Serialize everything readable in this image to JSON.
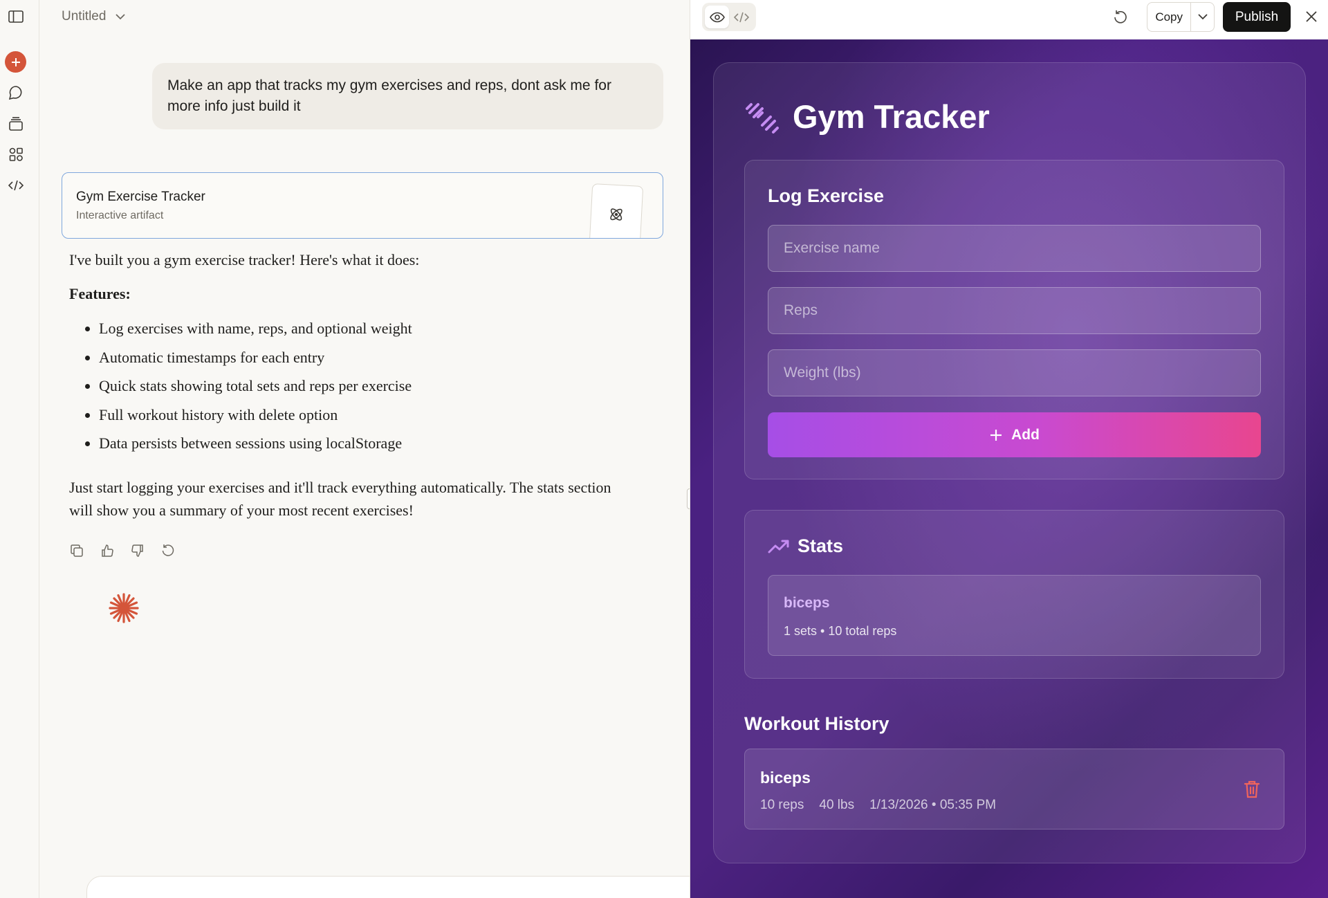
{
  "chat": {
    "title": "Untitled",
    "user_message": "Make an app that tracks my gym exercises and reps, dont ask me for more info just build it",
    "artifact_card": {
      "title": "Gym Exercise Tracker",
      "subtitle": "Interactive artifact"
    },
    "reply": {
      "intro": "I've built you a gym exercise tracker! Here's what it does:",
      "features_heading": "Features:",
      "features": [
        "Log exercises with name, reps, and optional weight",
        "Automatic timestamps for each entry",
        "Quick stats showing total sets and reps per exercise",
        "Full workout history with delete option",
        "Data persists between sessions using localStorage"
      ],
      "outro": "Just start logging your exercises and it'll track everything automatically. The stats section will show you a summary of your most recent exercises!"
    }
  },
  "toolbar": {
    "copy_label": "Copy",
    "publish_label": "Publish"
  },
  "app": {
    "title": "Gym Tracker",
    "log": {
      "heading": "Log Exercise",
      "exercise_placeholder": "Exercise name",
      "reps_placeholder": "Reps",
      "weight_placeholder": "Weight (lbs)",
      "add_label": "Add"
    },
    "stats": {
      "heading": "Stats",
      "items": [
        {
          "name": "biceps",
          "summary": "1 sets • 10 total reps"
        }
      ]
    },
    "history": {
      "heading": "Workout History",
      "items": [
        {
          "name": "biceps",
          "reps": "10 reps",
          "weight": "40 lbs",
          "timestamp": "1/13/2026 • 05:35 PM"
        }
      ]
    }
  },
  "colors": {
    "accent_orange": "#d4553a",
    "publish_bg": "#141413",
    "app_gradient_start": "#a64ee6",
    "app_gradient_end": "#e8468f",
    "stat_name": "#d8b8f8",
    "delete_icon": "#f0645c"
  },
  "icons": {
    "rail": [
      "sidebar-toggle-icon",
      "new-chat-icon",
      "chats-icon",
      "projects-icon",
      "artifacts-icon",
      "code-icon"
    ],
    "message_actions": [
      "copy-icon",
      "thumbs-up-icon",
      "thumbs-down-icon",
      "retry-icon"
    ],
    "toolbar": [
      "preview-eye-icon",
      "code-view-icon",
      "refresh-icon",
      "chevron-down-icon",
      "close-icon"
    ],
    "app": [
      "dumbbell-icon",
      "trending-up-icon",
      "plus-icon",
      "trash-icon"
    ]
  }
}
